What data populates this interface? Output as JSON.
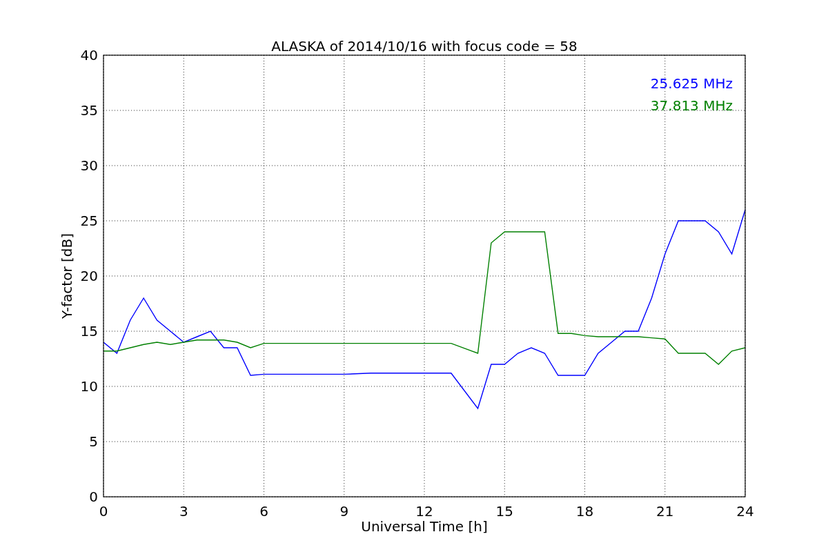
{
  "figure": {
    "chart_data": {
      "type": "line",
      "title": "ALASKA of 2014/10/16 with focus code = 58",
      "xlabel": "Universal Time [h]",
      "ylabel": "Y-factor [dB]",
      "x": [
        0,
        0.5,
        1,
        1.5,
        2,
        2.5,
        3,
        3.5,
        4,
        4.5,
        5,
        5.5,
        6,
        7,
        8,
        9,
        10,
        11,
        12,
        13,
        14,
        14.5,
        15,
        15.5,
        16,
        16.5,
        17,
        17.5,
        18,
        18.5,
        19,
        19.5,
        20,
        20.5,
        21,
        21.5,
        22,
        22.5,
        23,
        23.5,
        24
      ],
      "series": [
        {
          "name": "25.625 MHz",
          "color": "#0000ff",
          "values": [
            14,
            13,
            16,
            18,
            16,
            15,
            14,
            14.5,
            15,
            13.5,
            13.5,
            11,
            11.1,
            11.1,
            11.1,
            11.1,
            11.2,
            11.2,
            11.2,
            11.2,
            8,
            12,
            12,
            13,
            13.5,
            13,
            11,
            11,
            11,
            13,
            14,
            15,
            15,
            18,
            22,
            25,
            25,
            25,
            24,
            22,
            26
          ]
        },
        {
          "name": "37.813 MHz",
          "color": "#008000",
          "values": [
            13.2,
            13.2,
            13.5,
            13.8,
            14,
            13.8,
            14,
            14.2,
            14.2,
            14.2,
            14,
            13.5,
            13.9,
            13.9,
            13.9,
            13.9,
            13.9,
            13.9,
            13.9,
            13.9,
            13,
            23,
            24,
            24,
            24,
            24,
            14.8,
            14.8,
            14.6,
            14.5,
            14.5,
            14.5,
            14.5,
            14.4,
            14.3,
            13,
            13,
            13,
            12,
            13.2,
            13.5
          ]
        }
      ],
      "xlim": [
        0,
        24
      ],
      "ylim": [
        0,
        40
      ],
      "xticks": [
        0,
        3,
        6,
        9,
        12,
        15,
        18,
        21,
        24
      ],
      "yticks": [
        0,
        5,
        10,
        15,
        20,
        25,
        30,
        35,
        40
      ],
      "grid": true
    }
  }
}
